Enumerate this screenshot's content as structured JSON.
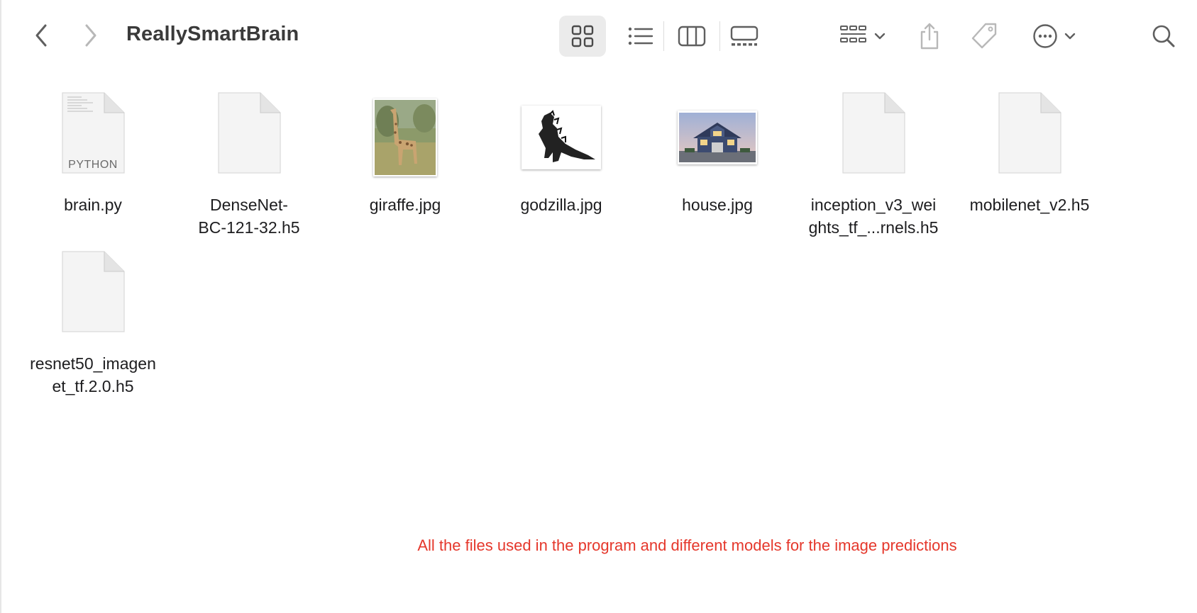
{
  "window": {
    "title": "ReallySmartBrain"
  },
  "toolbar": {
    "back_icon": "chevron-left-icon",
    "forward_icon": "chevron-right-icon",
    "views": [
      "icon-view",
      "list-view",
      "column-view",
      "gallery-view"
    ],
    "selected_view": "icon-view",
    "group_icon": "group-by-icon",
    "share_icon": "share-icon",
    "tag_icon": "tag-icon",
    "more_icon": "ellipsis-circle-icon",
    "search_icon": "search-icon"
  },
  "files": [
    {
      "name": "brain.py",
      "kind": "python-document",
      "badge": "PYTHON"
    },
    {
      "name": "DenseNet-\nBC-121-32.h5",
      "kind": "generic-document"
    },
    {
      "name": "giraffe.jpg",
      "kind": "image-thumbnail",
      "subject": "giraffe"
    },
    {
      "name": "godzilla.jpg",
      "kind": "image-thumbnail",
      "subject": "godzilla"
    },
    {
      "name": "house.jpg",
      "kind": "image-thumbnail",
      "subject": "house"
    },
    {
      "name": "inception_v3_wei\nghts_tf_...rnels.h5",
      "kind": "generic-document"
    },
    {
      "name": "mobilenet_v2.h5",
      "kind": "generic-document"
    },
    {
      "name": "resnet50_imagen\net_tf.2.0.h5",
      "kind": "generic-document"
    }
  ],
  "annotation": {
    "text": "All the files used in the program and different models for the image predictions",
    "color": "#e5372b"
  },
  "colors": {
    "selected_view_bg": "#ebebeb",
    "icon_gray": "#5f5f5f",
    "disabled_gray": "#b8b8b8"
  }
}
